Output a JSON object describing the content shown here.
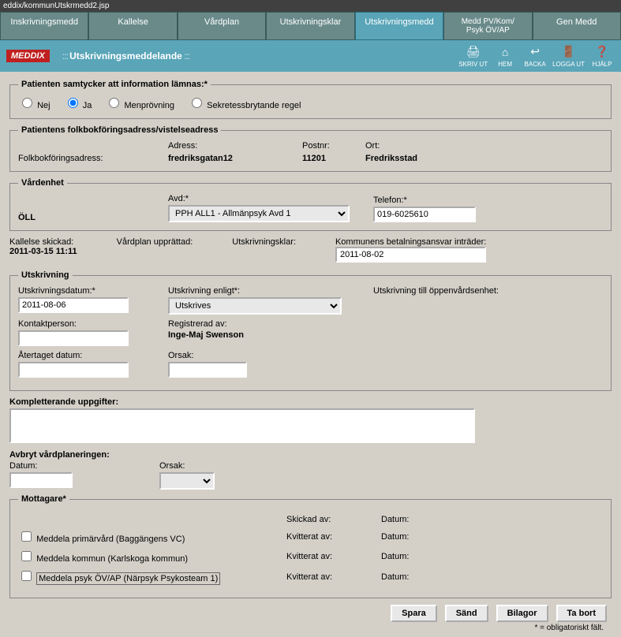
{
  "window": {
    "path": "eddix/kommunUtskrmedd2.jsp"
  },
  "tabs": [
    {
      "label": "Inskrivningsmedd"
    },
    {
      "label": "Kallelse"
    },
    {
      "label": "Vårdplan"
    },
    {
      "label": "Utskrivningsklar"
    },
    {
      "label": "Utskrivningsmedd",
      "active": true
    },
    {
      "label_line1": "Medd PV/Kom/",
      "label_line2": "Psyk ÖV/AP"
    },
    {
      "label": "Gen Medd"
    }
  ],
  "brand": "MEDDIX",
  "crumb": "Utskrivningsmeddelande",
  "tools": {
    "print": "SKRIV UT",
    "home": "HEM",
    "back": "BACKA",
    "logout": "LOGGA UT",
    "help": "HJÄLP"
  },
  "consent": {
    "legend": "Patienten samtycker att information lämnas:*",
    "options": {
      "nej": "Nej",
      "ja": "Ja",
      "men": "Menprövning",
      "sek": "Sekretessbrytande regel"
    },
    "selected": "ja"
  },
  "address": {
    "legend": "Patientens folkbokföringsadress/vistelseadress",
    "adr_label": "Adress:",
    "postnr_label": "Postnr:",
    "ort_label": "Ort:",
    "folk_label": "Folkbokföringsadress:",
    "adr_val": "fredriksgatan12",
    "postnr_val": "11201",
    "ort_val": "Fredriksstad"
  },
  "vardenhet": {
    "legend": "Vårdenhet",
    "oll": "ÖLL",
    "avd_label": "Avd:*",
    "avd_val": "PPH ALL1 - Allmänpsyk Avd 1",
    "tel_label": "Telefon:*",
    "tel_val": "019-6025610"
  },
  "status": {
    "kallelse_label": "Kallelse skickad:",
    "kallelse_val": "2011-03-15 11:11",
    "vardplan_label": "Vårdplan upprättad:",
    "utskrklar_label": "Utskrivningsklar:",
    "kommun_label": "Kommunens betalningsansvar inträder:",
    "kommun_val": "2011-08-02"
  },
  "utskrivning": {
    "legend": "Utskrivning",
    "datum_label": "Utskrivningsdatum:*",
    "datum_val": "2011-08-06",
    "enligt_label": "Utskrivning enligt*:",
    "enligt_val": "Utskrives",
    "oppen_label": "Utskrivning till öppenvårdsenhet:",
    "kontakt_label": "Kontaktperson:",
    "kontakt_val": "",
    "reg_label": "Registrerad av:",
    "reg_val": "Inge-Maj Swenson",
    "ater_label": "Återtaget datum:",
    "ater_val": "",
    "orsak_label": "Orsak:",
    "orsak_val": ""
  },
  "kompletterande_label": "Kompletterande uppgifter:",
  "kompletterande_val": "",
  "avbryt": {
    "heading": "Avbryt vårdplaneringen:",
    "datum_label": "Datum:",
    "datum_val": "",
    "orsak_label": "Orsak:"
  },
  "mottagare": {
    "legend": "Mottagare*",
    "skickad_label": "Skickad av:",
    "datum_label": "Datum:",
    "kvitterat_label": "Kvitterat av:",
    "items": [
      {
        "text": "Meddela primärvård (Baggängens VC)"
      },
      {
        "text": "Meddela kommun (Karlskoga kommun)"
      },
      {
        "text": "Meddela psyk ÖV/AP (Närpsyk Psykosteam 1)",
        "outlined": true
      }
    ]
  },
  "buttons": {
    "spara": "Spara",
    "sand": "Sänd",
    "bilagor": "Bilagor",
    "tabort": "Ta bort"
  },
  "mandatory_note": "* = obligatoriskt fält."
}
